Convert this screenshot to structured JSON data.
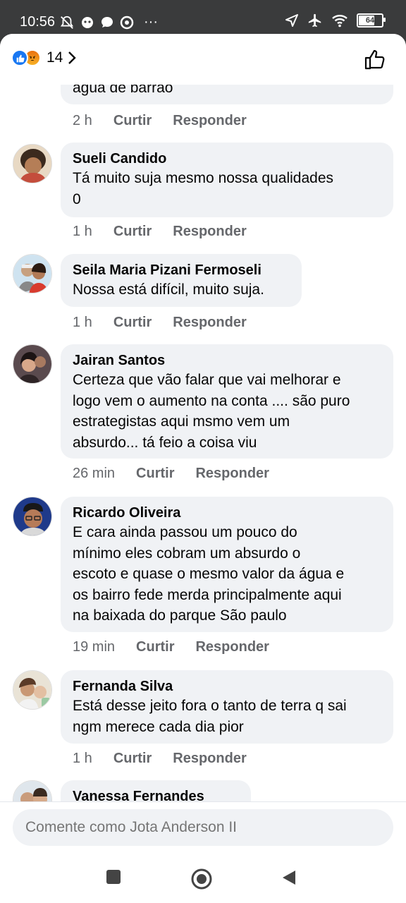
{
  "status_bar": {
    "time": "10:56",
    "more": "···",
    "battery": "64"
  },
  "header": {
    "reaction_count": "14",
    "reactions": [
      "like-icon",
      "angry-icon"
    ]
  },
  "comments": [
    {
      "author": "",
      "text": [
        "água de barrão"
      ],
      "time": "2 h",
      "like_label": "Curtir",
      "reply_label": "Responder"
    },
    {
      "author": "Sueli Candido",
      "text": [
        "Tá muito suja mesmo  nossa  qualidades",
        "0"
      ],
      "time": "1 h",
      "like_label": "Curtir",
      "reply_label": "Responder"
    },
    {
      "author": "Seila Maria Pizani Fermoseli",
      "text": [
        "Nossa está difícil, muito suja."
      ],
      "time": "1 h",
      "like_label": "Curtir",
      "reply_label": "Responder"
    },
    {
      "author": "Jairan Santos",
      "text": [
        "Certeza que vão falar que vai melhorar e",
        "logo vem o aumento na conta .... são puro",
        "estrategistas aqui msmo vem um",
        "absurdo... tá feio a coisa viu"
      ],
      "time": "26 min",
      "like_label": "Curtir",
      "reply_label": "Responder"
    },
    {
      "author": "Ricardo Oliveira",
      "text": [
        "E cara ainda passou um pouco do",
        "mínimo eles cobram um absurdo o",
        "escoto e quase o mesmo valor da água e",
        "os bairro fede merda principalmente aqui",
        "na baixada do parque São paulo"
      ],
      "time": "19 min",
      "like_label": "Curtir",
      "reply_label": "Responder"
    },
    {
      "author": "Fernanda Silva",
      "text": [
        "Está desse jeito fora o tanto de terra q sai",
        "ngm merece cada dia pior"
      ],
      "time": "1 h",
      "like_label": "Curtir",
      "reply_label": "Responder"
    },
    {
      "author": "Vanessa Fernandes",
      "text": [],
      "time": "",
      "like_label": "",
      "reply_label": ""
    }
  ],
  "composer": {
    "placeholder": "Comente como Jota Anderson II"
  },
  "colors": {
    "brand_blue": "#1877f2",
    "bubble_bg": "#f0f2f5",
    "meta_gray": "#65676b"
  }
}
